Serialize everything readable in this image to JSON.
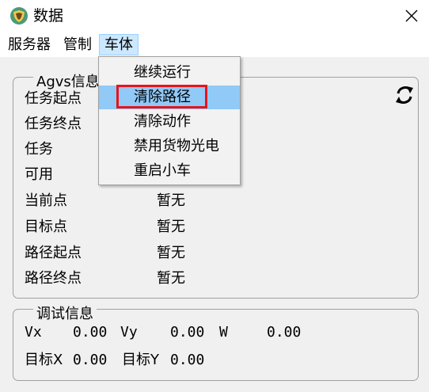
{
  "window": {
    "title": "数据",
    "icon": "shield-logo-icon",
    "close_icon": "close-icon"
  },
  "menubar": {
    "items": [
      {
        "label": "服务器"
      },
      {
        "label": "管制"
      },
      {
        "label": "车体",
        "active": true
      }
    ]
  },
  "dropdown": {
    "items": [
      {
        "label": "继续运行"
      },
      {
        "label": "清除路径",
        "hover": true,
        "highlighted": true
      },
      {
        "label": "清除动作"
      },
      {
        "label": "禁用货物光电"
      },
      {
        "label": "重启小车"
      }
    ]
  },
  "agv_info": {
    "title": "Agvs信息",
    "refresh_icon": "refresh-icon",
    "rows": [
      {
        "label": "任务起点",
        "value": ""
      },
      {
        "label": "任务终点",
        "value": ""
      },
      {
        "label": "任务",
        "value": ""
      },
      {
        "label": "可用",
        "value": ""
      },
      {
        "label": "当前点",
        "value": "暂无"
      },
      {
        "label": "目标点",
        "value": "暂无"
      },
      {
        "label": "路径起点",
        "value": "暂无"
      },
      {
        "label": "路径终点",
        "value": "暂无"
      }
    ]
  },
  "debug_info": {
    "title": "调试信息",
    "vx_label": "Vx",
    "vx_value": "0.00",
    "vy_label": "Vy",
    "vy_value": "0.00",
    "w_label": "W",
    "w_value": "0.00",
    "targetx_label": "目标X",
    "targetx_value": "0.00",
    "targety_label": "目标Y",
    "targety_value": "0.00"
  },
  "colors": {
    "highlight_border": "#e8141a",
    "menu_hover": "#91c9f7",
    "menu_active": "#cce8ff"
  }
}
